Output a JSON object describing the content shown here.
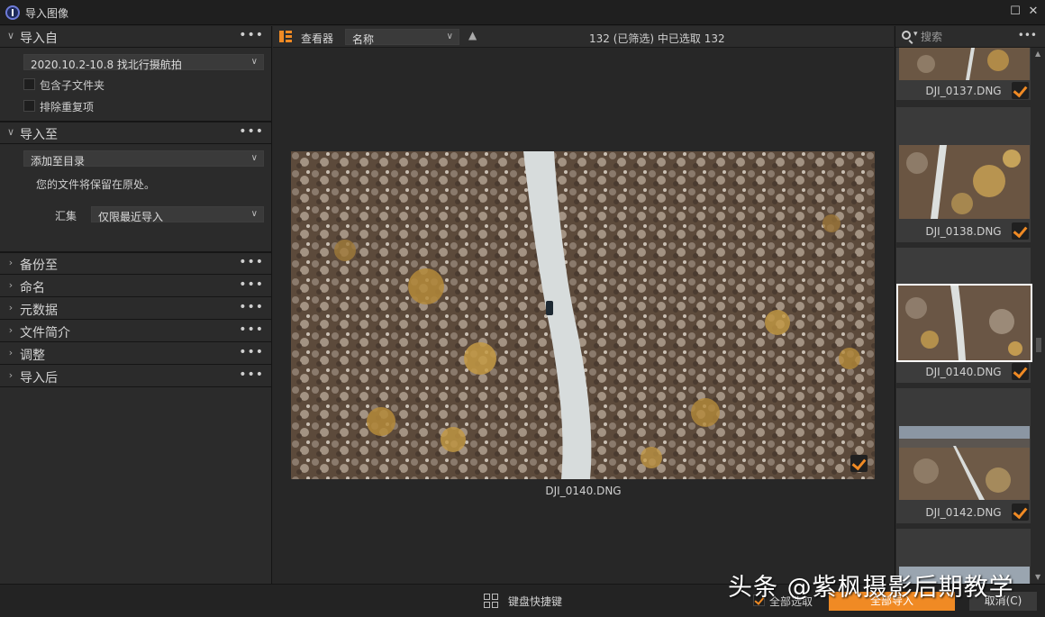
{
  "window": {
    "title": "导入图像"
  },
  "left": {
    "import_from": {
      "label": "导入自",
      "source": "2020.10.2-10.8 找北行摄航拍",
      "include_subfolders": "包含子文件夹",
      "exclude_duplicates": "排除重复项"
    },
    "import_to": {
      "label": "导入至",
      "destination": "添加至目录",
      "note": "您的文件将保留在原处。",
      "collection_label": "汇集",
      "collection_value": "仅限最近导入"
    },
    "sections": [
      "备份至",
      "命名",
      "元数据",
      "文件简介",
      "调整",
      "导入后"
    ]
  },
  "center": {
    "viewer_label": "查看器",
    "sort_value": "名称",
    "selection_status": "132 (已筛选) 中已选取 132",
    "preview_filename": "DJI_0140.DNG"
  },
  "right": {
    "search_placeholder": "搜索",
    "thumbnails": [
      "DJI_0137.DNG",
      "DJI_0138.DNG",
      "DJI_0140.DNG",
      "DJI_0142.DNG"
    ]
  },
  "bottom": {
    "keyboard_shortcuts": "键盘快捷键",
    "select_all": "全部选取",
    "import_all": "全部导入",
    "cancel": "取消(C)"
  },
  "watermark": "头条 @紫枫摄影后期教学",
  "colors": {
    "accent": "#f08a24",
    "background": "#262626"
  }
}
